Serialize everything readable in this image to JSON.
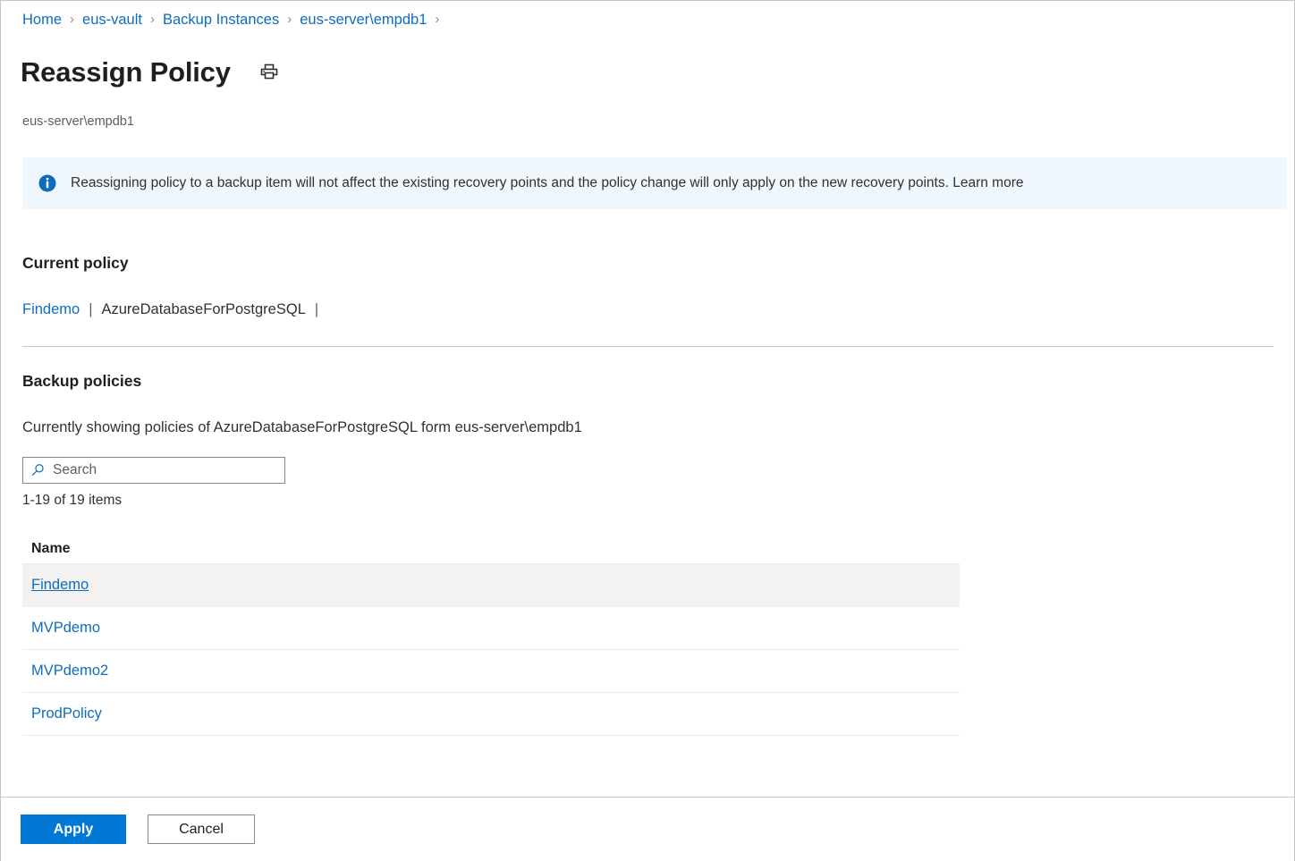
{
  "breadcrumb": {
    "separator": "›",
    "items": [
      {
        "label": "Home"
      },
      {
        "label": "eus-vault"
      },
      {
        "label": "Backup Instances"
      },
      {
        "label": "eus-server\\empdb1"
      }
    ]
  },
  "header": {
    "title": "Reassign Policy",
    "subtitle": "eus-server\\empdb1",
    "print_icon": "printer-icon"
  },
  "banner": {
    "icon": "info-icon",
    "text": "Reassigning policy to a backup item will not affect the existing recovery points and the policy change will only apply on the new recovery points. Learn more",
    "background": "#eff6fc",
    "icon_color": "#0f6cbd"
  },
  "current_policy": {
    "heading": "Current policy",
    "policy_name": "Findemo",
    "separator": "|",
    "datasource_type": "AzureDatabaseForPostgreSQL",
    "trailing_separator": "|"
  },
  "backup_policies": {
    "heading": "Backup policies",
    "showing_text": "Currently showing policies of AzureDatabaseForPostgreSQL form eus-server\\empdb1",
    "search": {
      "icon": "search-icon",
      "placeholder": "Search",
      "value": ""
    },
    "item_count": "1-19 of 19 items",
    "columns": [
      "Name"
    ],
    "rows": [
      {
        "name": "Findemo",
        "selected": true
      },
      {
        "name": "MVPdemo",
        "selected": false
      },
      {
        "name": "MVPdemo2",
        "selected": false
      },
      {
        "name": "ProdPolicy",
        "selected": false
      }
    ]
  },
  "footer": {
    "apply_label": "Apply",
    "cancel_label": "Cancel"
  },
  "colors": {
    "link": "#0f6cbd",
    "primary_button": "#0078d4",
    "selected_row": "#f3f2f1",
    "banner_bg": "#eff6fc",
    "border": "#c8c6c4"
  }
}
